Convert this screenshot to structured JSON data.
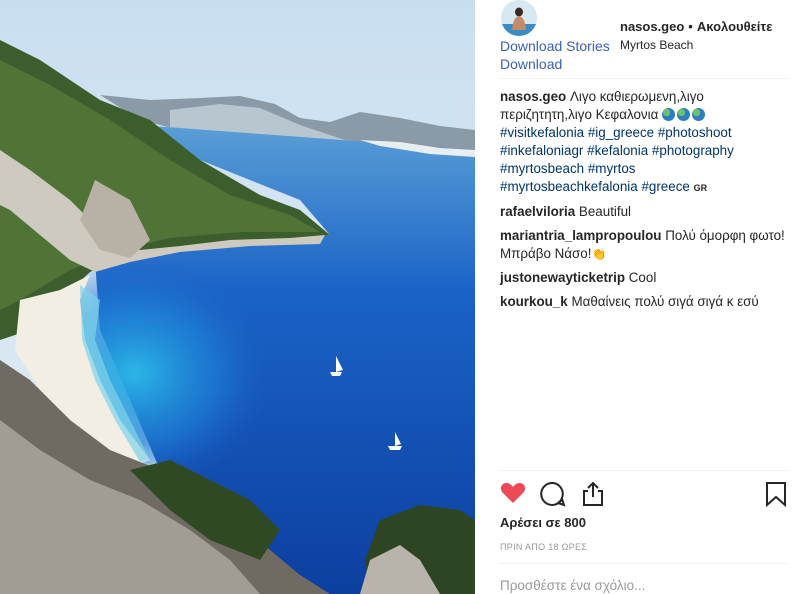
{
  "post": {
    "username": "nasos.geo",
    "separator": "•",
    "follow_label": "Ακολουθείτε",
    "location": "Myrtos Beach",
    "download_stories": "Download Stories",
    "download": "Download"
  },
  "caption": {
    "username": "nasos.geo",
    "text": "Λιγο καθιερωμενη,λιγο περιζητητη,λιγο Κεφαλονια",
    "emoji_icons": [
      "globe-icon",
      "globe-icon",
      "globe-icon"
    ],
    "hashtags": [
      "#visitkefalonia",
      "#ig_greece",
      "#photoshoot",
      "#inkefaloniagr",
      "#kefalonia",
      "#photography",
      "#myrtosbeach",
      "#myrtos",
      "#myrtosbeachkefalonia",
      "#greece"
    ],
    "flag_text": "GR"
  },
  "comments": [
    {
      "username": "rafaelviloria",
      "text": "Beautiful"
    },
    {
      "username": "mariantria_lampropoulou",
      "text": "Πολύ όμορφη φωτο! Μπράβο Νάσο!",
      "emoji_icon": "clapping-hands-icon"
    },
    {
      "username": "justonewayticketrip",
      "text": "Cool"
    },
    {
      "username": "kourkou_k",
      "text": "Μαθαίνεις πολύ σιγά σιγά κ εσύ"
    }
  ],
  "actions": {
    "like_icon": "heart-icon",
    "comment_icon": "speech-bubble-icon",
    "share_icon": "share-icon",
    "save_icon": "bookmark-icon",
    "like_color": "#ed4956"
  },
  "likes_text": "Αρέσει σε 800",
  "timestamp": "ΠΡΙΝ ΑΠΟ 18 ΩΡΕΣ",
  "add_comment_placeholder": "Προσθέστε ένα σχόλιο..."
}
